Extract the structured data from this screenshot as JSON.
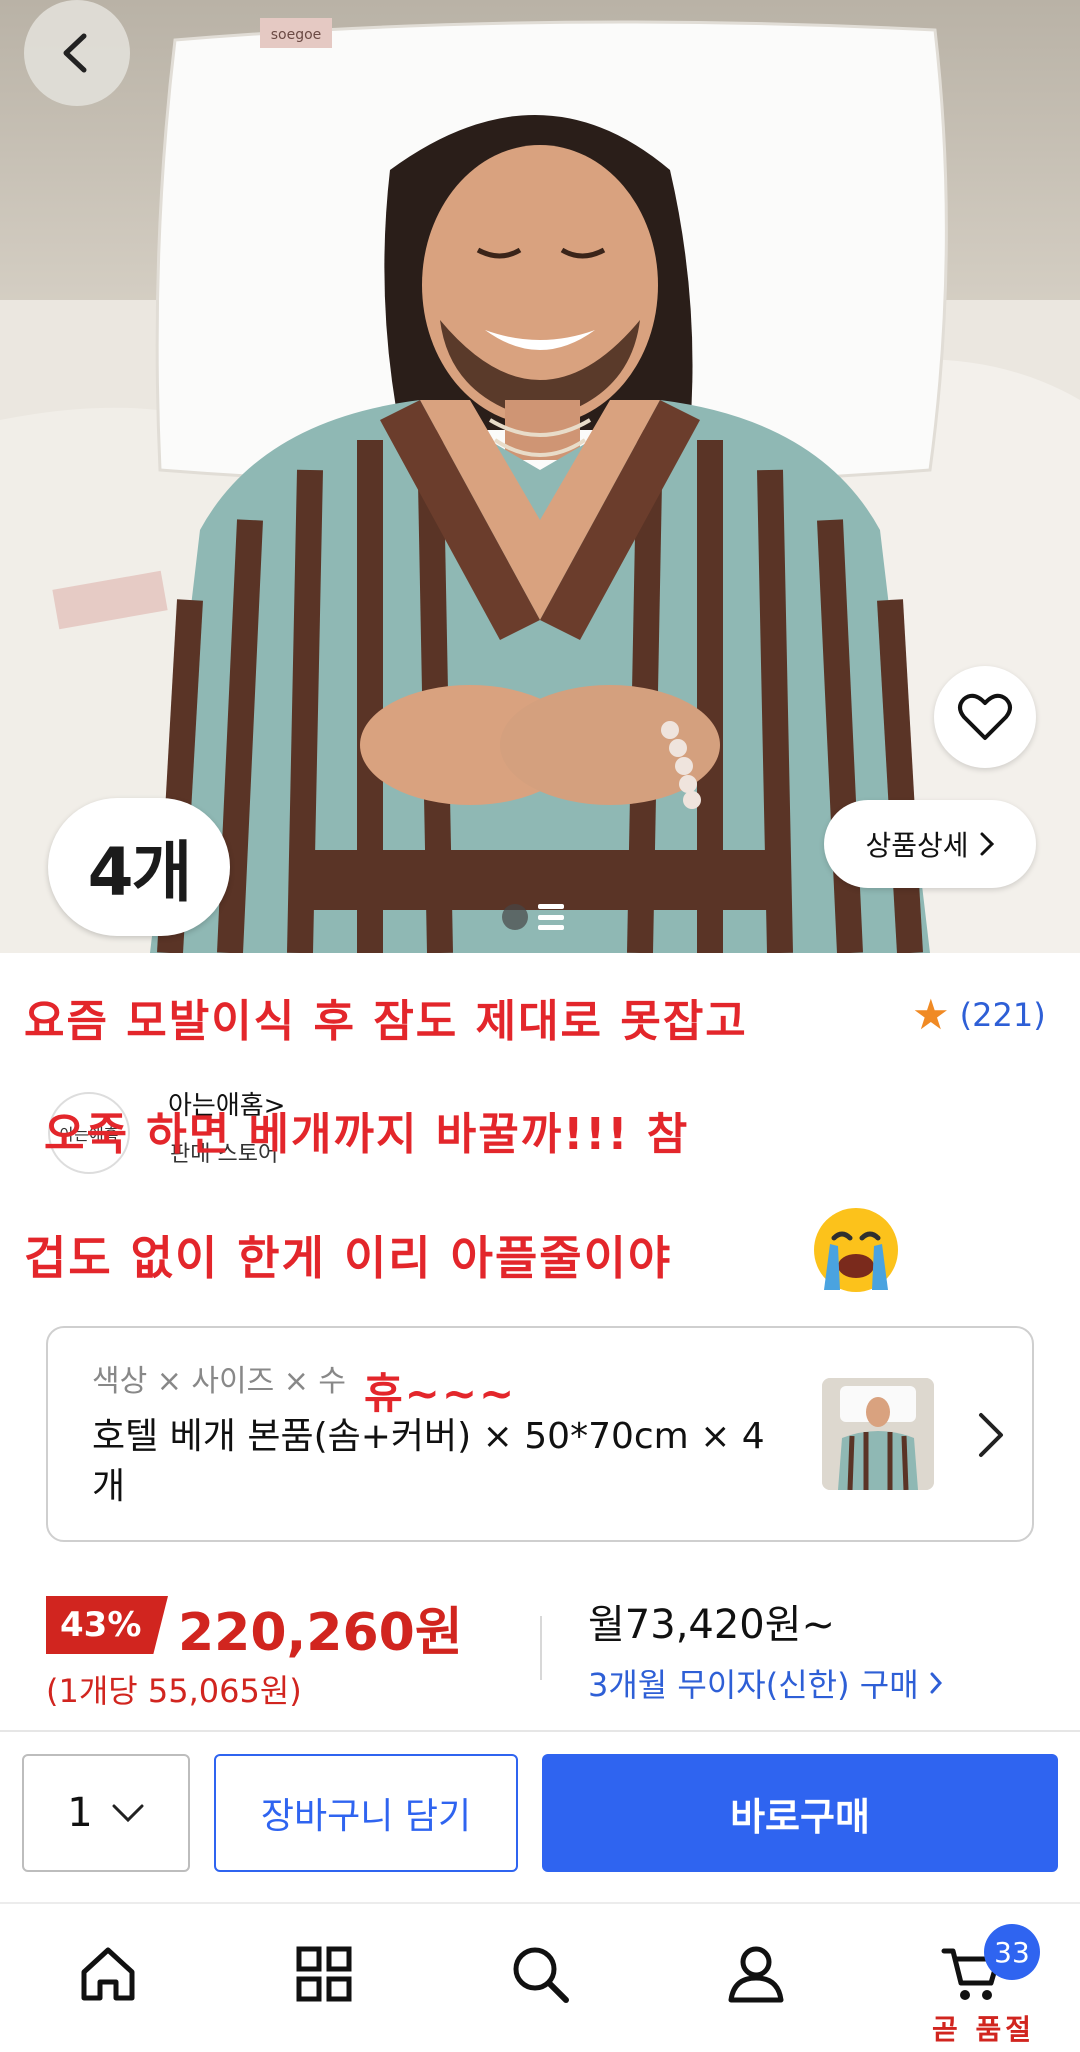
{
  "hero": {
    "count_badge": "4개",
    "detail_button": "상품상세",
    "brand_tag": "soegoe"
  },
  "title": {
    "line1": "요즘 모발이식 후  잠도 제대로 못잡고",
    "line2": "오죽 하면 베개까지 바꿀까!!! 참",
    "line3": "겁도 없이 한게 이리 아플줄이야",
    "rating_count": "(221)",
    "store_name": "아는애홈>",
    "store_sub": "판매 스토어",
    "store_logo": "아는애홈"
  },
  "option": {
    "label": "색상 × 사이즈 × 수",
    "value": "호텔 베개 본품(솜+커버) × 50*70cm × 4개",
    "handwritten": "휴~~~"
  },
  "price": {
    "discount": "43%",
    "price": "220,260원",
    "unit_price": "(1개당 55,065원)",
    "monthly": "월73,420원~",
    "installment": "3개월 무이자(신한) 구매"
  },
  "buy_bar": {
    "quantity": "1",
    "cart_label": "장바구니 담기",
    "buy_label": "바로구매"
  },
  "nav": {
    "items": [
      "home-icon",
      "grid-icon",
      "search-icon",
      "user-icon",
      "cart-icon"
    ],
    "cart_badge": "33",
    "soon_soldout": "곧 품절"
  },
  "colors": {
    "accent_blue": "#2f64f0",
    "price_red": "#d1251f",
    "handwriting_red": "#e3262b",
    "star_orange": "#f08a24"
  }
}
